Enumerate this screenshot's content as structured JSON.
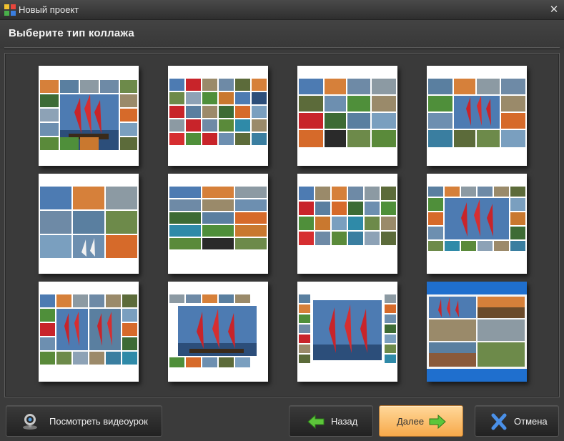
{
  "window": {
    "title": "Новый проект",
    "app_icon": "app-logo-icon",
    "close_icon": "close-icon"
  },
  "header": {
    "title": "Выберите тип коллажа"
  },
  "templates": {
    "selected_index": 11,
    "selected_color": "#1f6fce",
    "count": 12
  },
  "buttons": {
    "tutorial": {
      "label": "Посмотреть видеоурок",
      "icon": "webcam-icon"
    },
    "back": {
      "label": "Назад",
      "icon": "arrow-left-icon"
    },
    "next": {
      "label": "Далее",
      "icon": "arrow-right-icon"
    },
    "cancel": {
      "label": "Отмена",
      "icon": "x-icon"
    }
  }
}
